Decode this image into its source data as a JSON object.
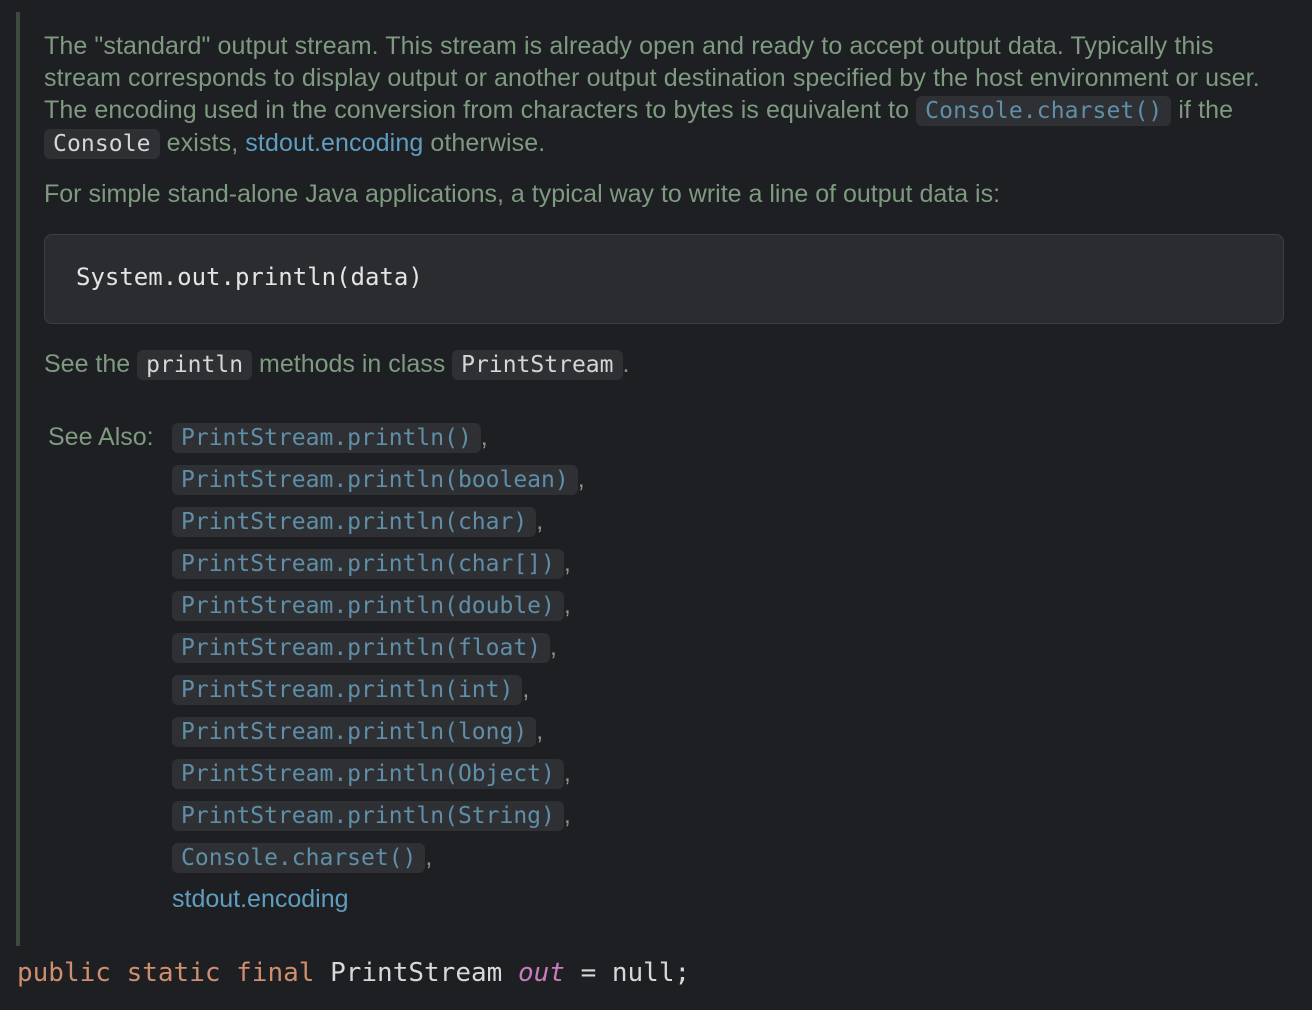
{
  "doc": {
    "para1_before": "The \"standard\" output stream. This stream is already open and ready to accept output data. Typically this stream corresponds to display output or another output destination specified by the host environment or user. The encoding used in the conversion from characters to bytes is equivalent to ",
    "para1_chip_console_charset": "Console.charset()",
    "para1_if_the": " if the ",
    "para1_chip_console": "Console",
    "para1_exists": " exists, ",
    "para1_link_stdout": "stdout.encoding",
    "para1_after": " otherwise.",
    "para2": "For simple stand-alone Java applications, a typical way to write a line of output data is:",
    "code_block": "System.out.println(data)",
    "para3_before": "See the ",
    "para3_chip_println": "println",
    "para3_mid": " methods in class ",
    "para3_chip_printstream": "PrintStream",
    "para3_after": ".",
    "see_also_label": "See Also:",
    "see_also_items": [
      "PrintStream.println()",
      "PrintStream.println(boolean)",
      "PrintStream.println(char)",
      "PrintStream.println(char[])",
      "PrintStream.println(double)",
      "PrintStream.println(float)",
      "PrintStream.println(int)",
      "PrintStream.println(long)",
      "PrintStream.println(Object)",
      "PrintStream.println(String)",
      "Console.charset()"
    ],
    "see_also_separator": ",",
    "see_also_last_link": "stdout.encoding"
  },
  "signature": {
    "kw_public": "public",
    "kw_static": "static",
    "kw_final": "final",
    "type": "PrintStream",
    "field": "out",
    "assign": "=",
    "value": "null;"
  },
  "colors": {
    "background": "#1e1f22",
    "doc_text": "#7e9a80",
    "link": "#5f9ec0",
    "keyword": "#cf8e6d",
    "field": "#c77dbb"
  }
}
